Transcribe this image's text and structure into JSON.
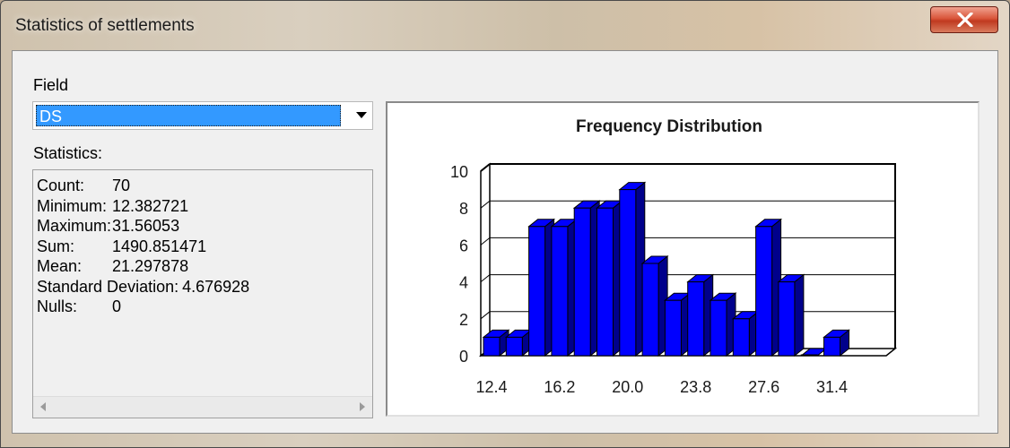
{
  "window": {
    "title": "Statistics of settlements"
  },
  "field": {
    "label": "Field",
    "selected": "DS"
  },
  "statistics": {
    "label": "Statistics:",
    "rows": [
      {
        "name": "Count:",
        "value": "70"
      },
      {
        "name": "Minimum:",
        "value": "12.382721"
      },
      {
        "name": "Maximum:",
        "value": "31.56053"
      },
      {
        "name": "Sum:",
        "value": "1490.851471"
      },
      {
        "name": "Mean:",
        "value": "21.297878"
      },
      {
        "name": "Standard Deviation:",
        "value": "4.676928"
      },
      {
        "name": "Nulls:",
        "value": "0"
      }
    ]
  },
  "icons": {
    "close": "close-icon",
    "dropdown": "chevron-down-icon",
    "scroll_left": "arrow-left-icon",
    "scroll_right": "arrow-right-icon"
  },
  "colors": {
    "bar": "#0000ff",
    "bar_side": "#00008b",
    "selection": "#3399ff"
  },
  "chart_data": {
    "type": "bar",
    "title": "Frequency Distribution",
    "xlabel": "",
    "ylabel": "",
    "ylim": [
      0,
      10
    ],
    "yticks": [
      "0",
      "2",
      "4",
      "6",
      "8",
      "10"
    ],
    "xticks": [
      "12.4",
      "16.2",
      "20.0",
      "23.8",
      "27.6",
      "31.4"
    ],
    "values": [
      1,
      1,
      7,
      7,
      8,
      8,
      9,
      5,
      3,
      4,
      3,
      2,
      7,
      4,
      0,
      1
    ],
    "grid": true,
    "style": "3d"
  }
}
